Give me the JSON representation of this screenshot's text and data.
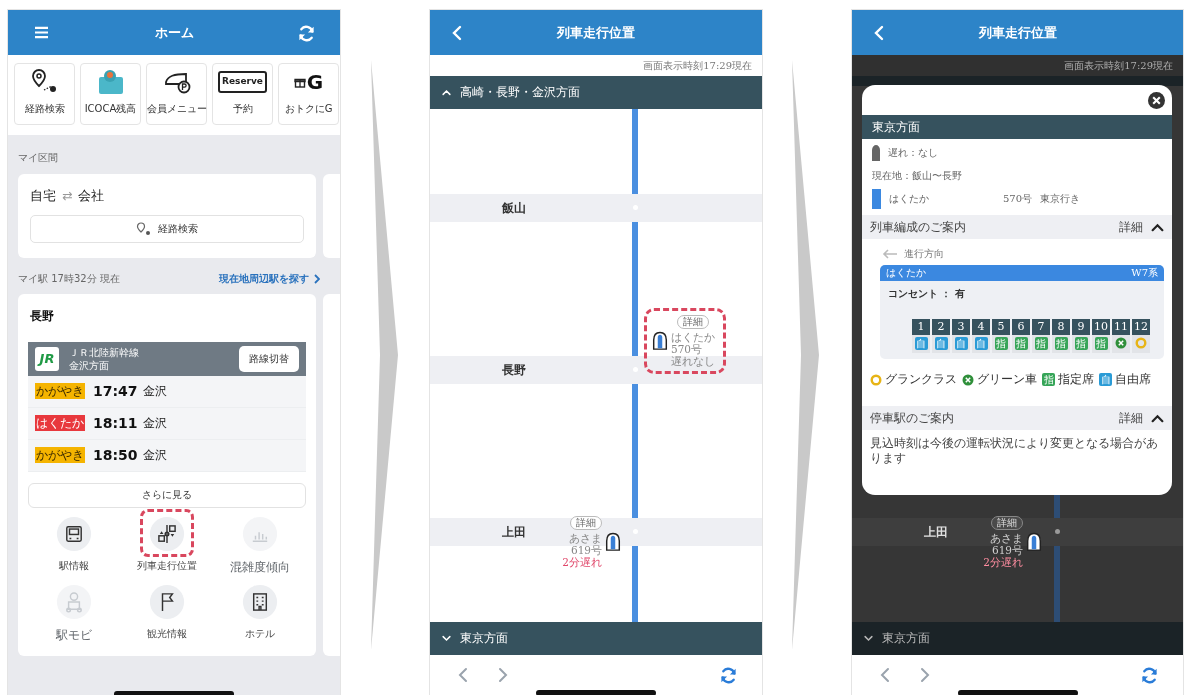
{
  "home": {
    "title": "ホーム",
    "shortcuts": [
      {
        "kind": "route",
        "label": "経路検索"
      },
      {
        "kind": "card",
        "label": "ICOCA残高"
      },
      {
        "kind": "member",
        "label": "会員メニュー"
      },
      {
        "kind": "reserve",
        "label": "予約",
        "icon_text": "Reserve"
      },
      {
        "kind": "deals",
        "label": "おトクにG",
        "icon_text": "G"
      }
    ],
    "my_route": {
      "heading": "マイ区間",
      "from": "自宅",
      "arrow": "⇄",
      "to": "会社",
      "search_button": "経路検索"
    },
    "my_station": {
      "heading": "マイ駅 17時32分 現在",
      "nearby_link": "現在地周辺駅を探す",
      "station": "長野",
      "line": {
        "logo_text": "JR",
        "name": "ＪＲ北陸新幹線",
        "direction": "金沢方面",
        "switch_button": "路線切替"
      },
      "departures": [
        {
          "train": "かがやき",
          "color": "#f5b400",
          "time": "17:47",
          "destination": "金沢"
        },
        {
          "train": "はくたか",
          "color": "#e8383d",
          "time": "18:11",
          "destination": "金沢"
        },
        {
          "train": "かがやき",
          "color": "#f5b400",
          "time": "18:50",
          "destination": "金沢"
        }
      ],
      "more_button": "さらに見る"
    },
    "features": [
      {
        "kind": "station",
        "label": "駅情報",
        "disabled": false,
        "highlighted": false
      },
      {
        "kind": "train_position",
        "label": "列車走行位置",
        "disabled": false,
        "highlighted": true
      },
      {
        "kind": "congestion",
        "label": "混雑度傾向",
        "disabled": true,
        "highlighted": false
      },
      {
        "kind": "mobi",
        "label": "駅モビ",
        "disabled": true,
        "highlighted": false
      },
      {
        "kind": "sightseeing",
        "label": "観光情報",
        "disabled": false,
        "highlighted": false
      },
      {
        "kind": "hotel",
        "label": "ホテル",
        "disabled": false,
        "highlighted": false
      }
    ]
  },
  "position": {
    "title": "列車走行位置",
    "timestamp": "画面表示時刻17:29現在",
    "up_section": {
      "label": "高崎・長野・金沢方面",
      "expanded": true
    },
    "stations": [
      {
        "name": "飯山"
      },
      {
        "name": "長野",
        "trains": [
          {
            "kind": "outbound",
            "detail_button": "詳細",
            "name": "はくたか",
            "number": "570号",
            "status": "遅れなし",
            "delayed": false,
            "highlighted": true
          }
        ]
      },
      {
        "name": "上田",
        "trains": [
          {
            "kind": "inbound",
            "detail_button": "詳細",
            "name": "あさま",
            "number": "619号",
            "status": "2分遅れ",
            "delayed": true,
            "highlighted": false
          }
        ]
      }
    ],
    "down_section": {
      "label": "東京方面",
      "expanded": false
    }
  },
  "detail": {
    "title": "列車走行位置",
    "timestamp": "画面表示時刻17:29現在",
    "stations": [
      {
        "name": "上田",
        "trains": [
          {
            "kind": "inbound",
            "detail_button": "詳細",
            "name": "あさま",
            "number": "619号",
            "status": "2分遅れ",
            "delayed": true,
            "highlighted": false
          }
        ]
      }
    ],
    "down_section": {
      "label": "東京方面",
      "expanded": false
    },
    "modal": {
      "heading": "東京方面",
      "delay": "遅れ：なし",
      "location": "現在地：飯山〜長野",
      "train_name": "はくたか",
      "train_number": "570号",
      "destination": "東京行き",
      "formation": {
        "title": "列車編成のご案内",
        "detail_link": "詳細",
        "expanded": true,
        "direction": "進行方向",
        "train": "はくたか",
        "series": "W7系",
        "outlet": "コンセント ： 有",
        "cars": [
          {
            "number": "1",
            "kind": "non_reserved",
            "mark": "自"
          },
          {
            "number": "2",
            "kind": "non_reserved",
            "mark": "自"
          },
          {
            "number": "3",
            "kind": "non_reserved",
            "mark": "自"
          },
          {
            "number": "4",
            "kind": "non_reserved",
            "mark": "自"
          },
          {
            "number": "5",
            "kind": "reserved",
            "mark": "指"
          },
          {
            "number": "6",
            "kind": "reserved",
            "mark": "指"
          },
          {
            "number": "7",
            "kind": "reserved",
            "mark": "指"
          },
          {
            "number": "8",
            "kind": "reserved",
            "mark": "指"
          },
          {
            "number": "9",
            "kind": "reserved",
            "mark": "指"
          },
          {
            "number": "10",
            "kind": "reserved",
            "mark": "指"
          },
          {
            "number": "11",
            "kind": "green"
          },
          {
            "number": "12",
            "kind": "gran_class"
          }
        ],
        "legend": [
          {
            "kind": "gran_class",
            "label": "グランクラス"
          },
          {
            "kind": "green",
            "label": "グリーン車"
          },
          {
            "kind": "reserved",
            "mark": "指",
            "label": "指定席"
          },
          {
            "kind": "non_reserved",
            "mark": "自",
            "label": "自由席"
          }
        ]
      },
      "stops": {
        "title": "停車駅のご案内",
        "detail_link": "詳細",
        "expanded": true,
        "note": "見込時刻は今後の運転状況により変更となる場合があります"
      }
    }
  }
}
